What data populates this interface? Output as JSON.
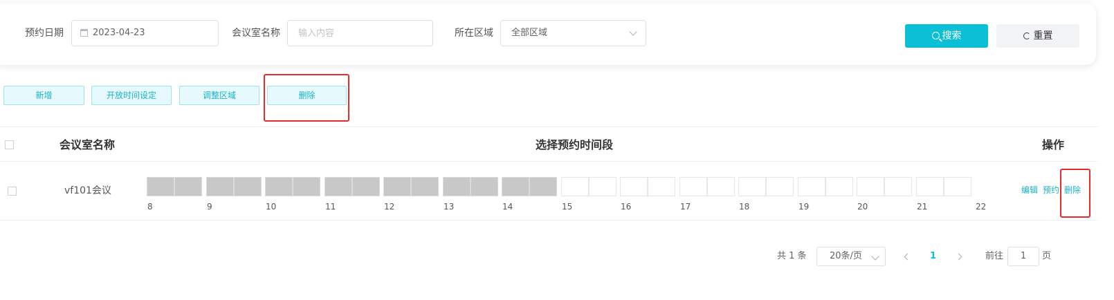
{
  "search": {
    "date_label": "预约日期",
    "date_value": "2023-04-23",
    "name_label": "会议室名称",
    "name_placeholder": "输入内容",
    "area_label": "所在区域",
    "area_value": "全部区域",
    "search_button": "搜索",
    "reset_button": "重置"
  },
  "toolbar": {
    "add": "新增",
    "open_time": "开放时间设定",
    "adjust_area": "调整区域",
    "delete": "删除"
  },
  "table": {
    "columns": [
      "会议室名称",
      "选择预约时间段",
      "操作"
    ],
    "rows": [
      {
        "name": "vf101会议",
        "booked_slots": 14,
        "total_slots": 28,
        "actions": [
          "编辑",
          "预约",
          "删除"
        ]
      }
    ],
    "hour_labels": [
      "8",
      "9",
      "10",
      "11",
      "12",
      "13",
      "14",
      "15",
      "16",
      "17",
      "18",
      "19",
      "20",
      "21",
      "22"
    ]
  },
  "pagination": {
    "total": "共 1 条",
    "page_size": "20条/页",
    "current_page": "1",
    "goto_label": "前往",
    "goto_value": "1",
    "page_suffix": "页"
  },
  "colors": {
    "accent": "#0bbfd6",
    "booked": "#c8c8c8",
    "highlight": "#e8292c"
  }
}
